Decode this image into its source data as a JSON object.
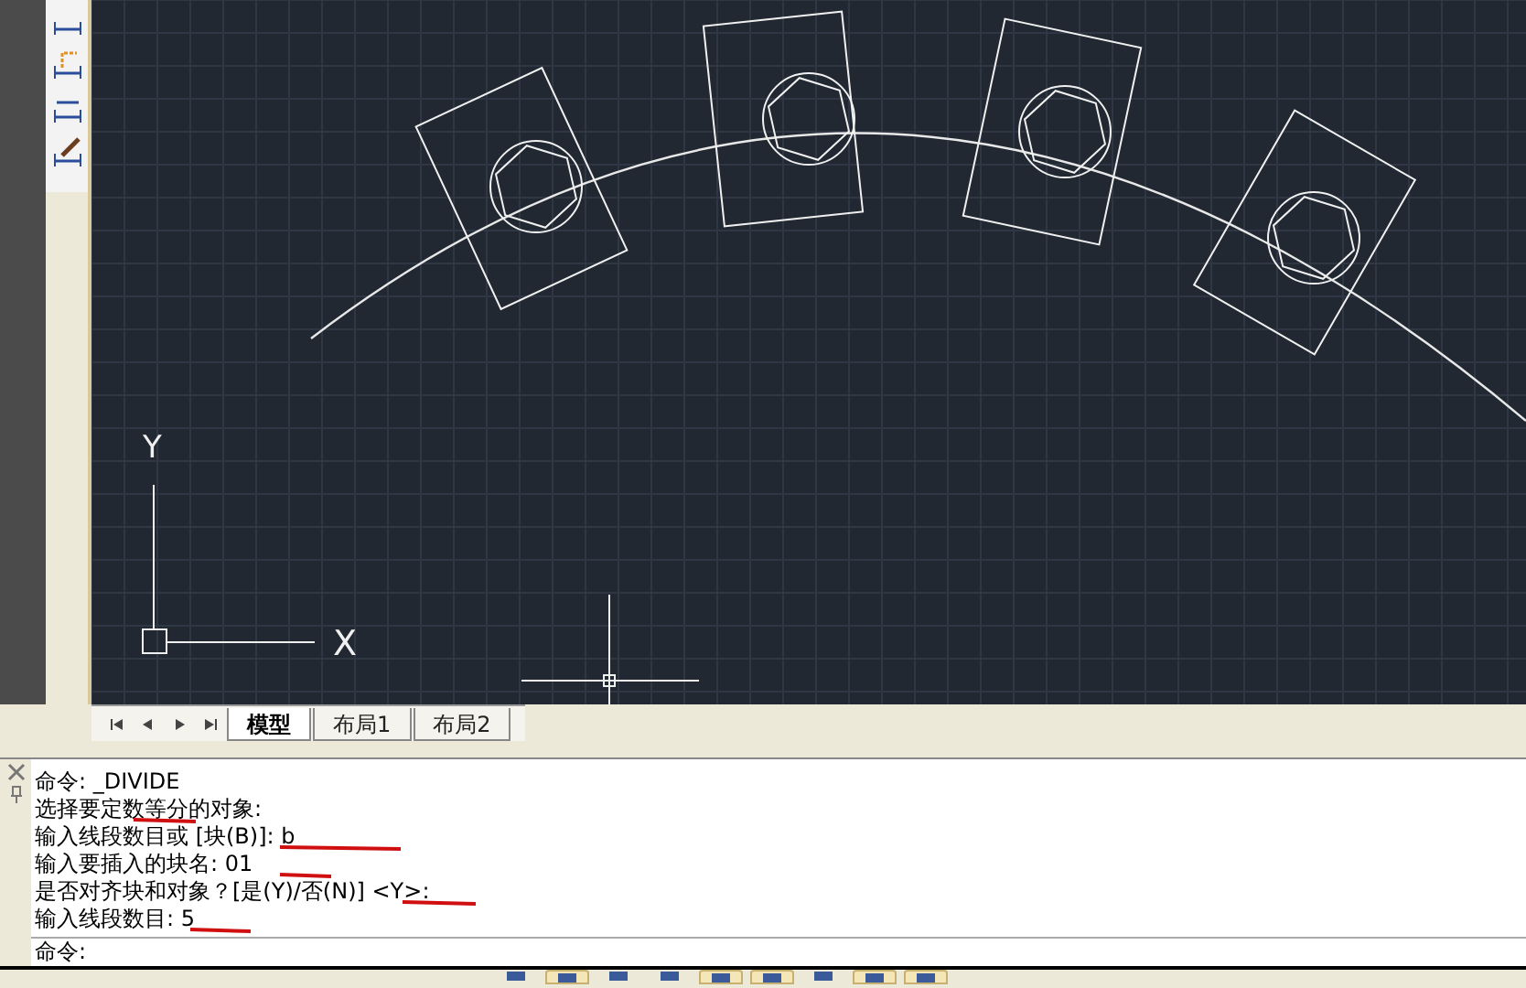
{
  "canvas": {
    "axis_labels": [
      "Y",
      "X"
    ]
  },
  "layout_tabs": [
    {
      "label": "模型",
      "selected": true
    },
    {
      "label": "布局1",
      "selected": false
    },
    {
      "label": "布局2",
      "selected": false
    }
  ],
  "command_history": [
    "命令: _DIVIDE",
    "选择要定数等分的对象:",
    "输入线段数目或 [块(B)]: b",
    "输入要插入的块名: 01",
    "是否对齐块和对象？[是(Y)/否(N)] <Y>:",
    "输入线段数目: 5"
  ],
  "command_prompt": "命令:"
}
